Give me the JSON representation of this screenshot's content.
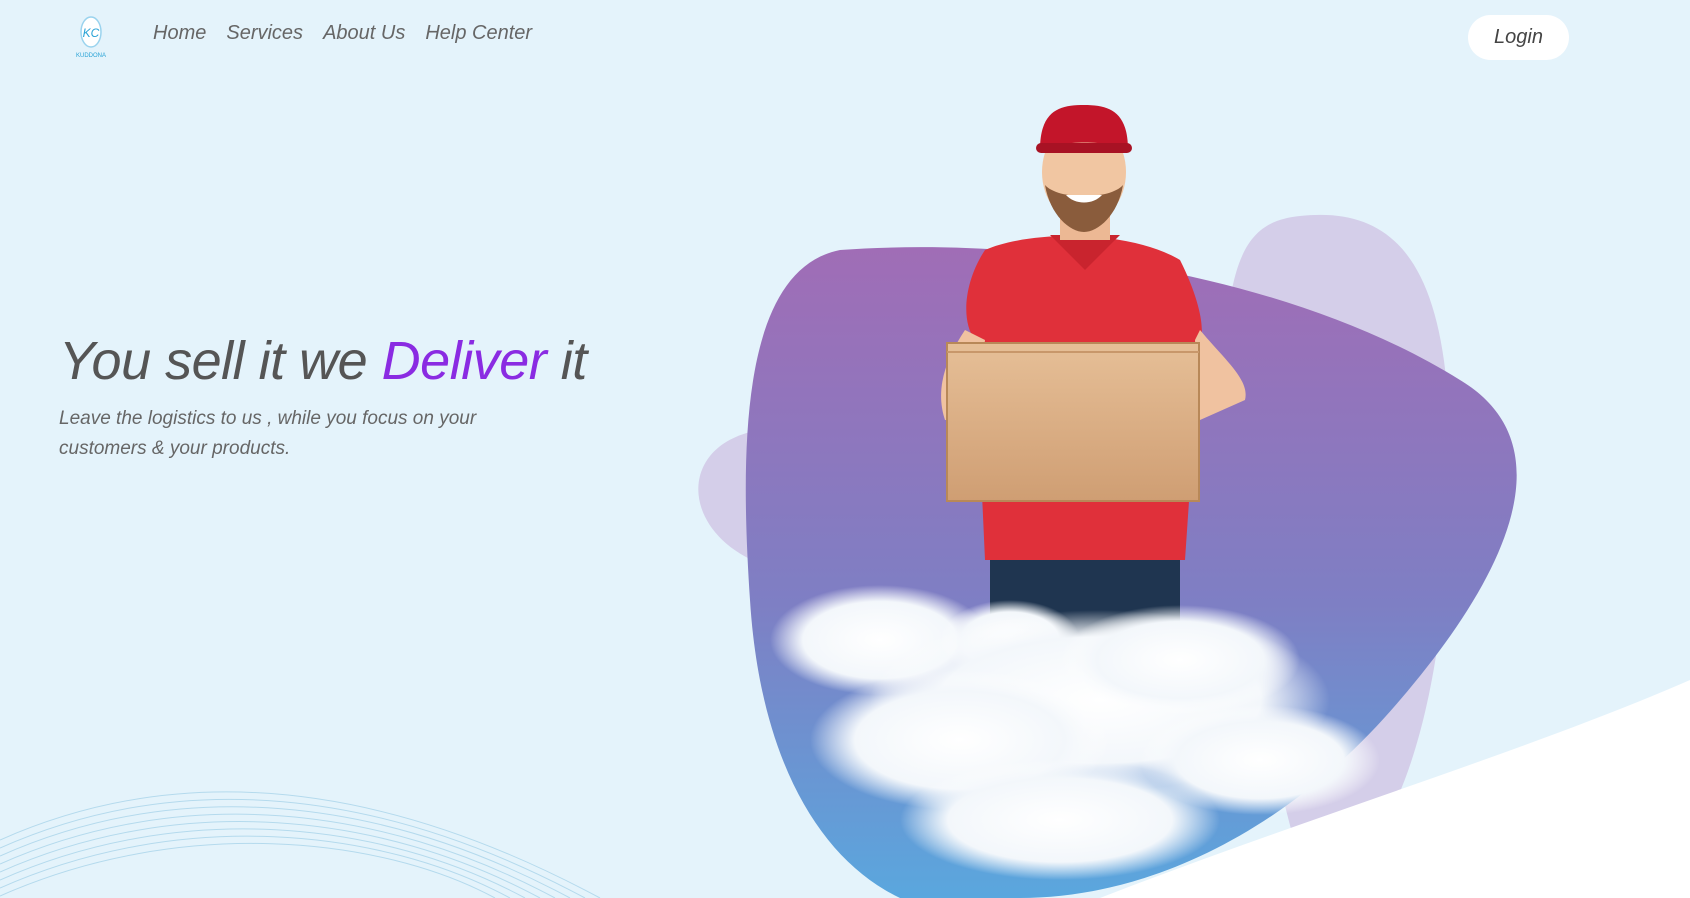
{
  "brand": {
    "logo_icon": "brand-logo-icon",
    "logo_letters": "KC",
    "logo_wordmark": "KUDDONA"
  },
  "nav": {
    "items": [
      {
        "label": "Home"
      },
      {
        "label": "Services"
      },
      {
        "label": "About Us"
      },
      {
        "label": "Help Center"
      }
    ],
    "login_label": "Login"
  },
  "hero": {
    "title_part1": "You sell it we ",
    "title_accent": "Deliver",
    "title_part2": " it",
    "subtitle": "Leave the logistics to us , while you focus on your customers & your products.",
    "illustration_icon": "delivery-man-with-box-icon"
  },
  "colors": {
    "background": "#e4f3fb",
    "accent": "#8a2be2",
    "blob_top": "#9b59b6",
    "blob_bottom": "#6fa8dc",
    "shirt": "#e0303a",
    "cap": "#c3152a",
    "box": "#d9aa7e"
  }
}
